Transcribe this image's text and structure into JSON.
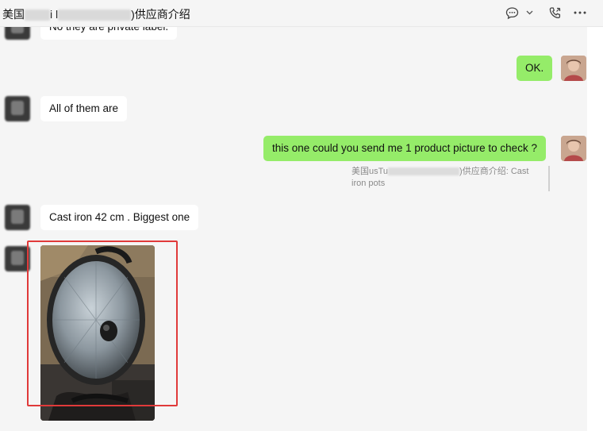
{
  "header": {
    "title_prefix": "美国",
    "title_mid": "i l",
    "title_suffix": ")供应商介绍",
    "icons": [
      "chat-bubble-icon",
      "chevron-down-icon",
      "phone-icon",
      "more-icon"
    ]
  },
  "messages": [
    {
      "side": "in",
      "text": "No they are private label."
    },
    {
      "side": "out",
      "text": "OK."
    },
    {
      "side": "in",
      "text": "All of them are"
    },
    {
      "side": "out",
      "text": "this one could you send me 1 product picture to check ?"
    },
    {
      "side": "in",
      "text": "Cast iron 42 cm . Biggest one"
    }
  ],
  "quote": {
    "prefix": "美国usTu",
    "suffix": ")供应商介绍: Cast",
    "line2": "iron pots"
  },
  "image_message": {
    "subject": "cast-iron-pot-with-glass-lid",
    "highlight_color": "#e03a3a"
  },
  "colors": {
    "outgoing_bubble": "#95ec69",
    "incoming_bubble": "#ffffff",
    "background": "#f5f5f5"
  }
}
